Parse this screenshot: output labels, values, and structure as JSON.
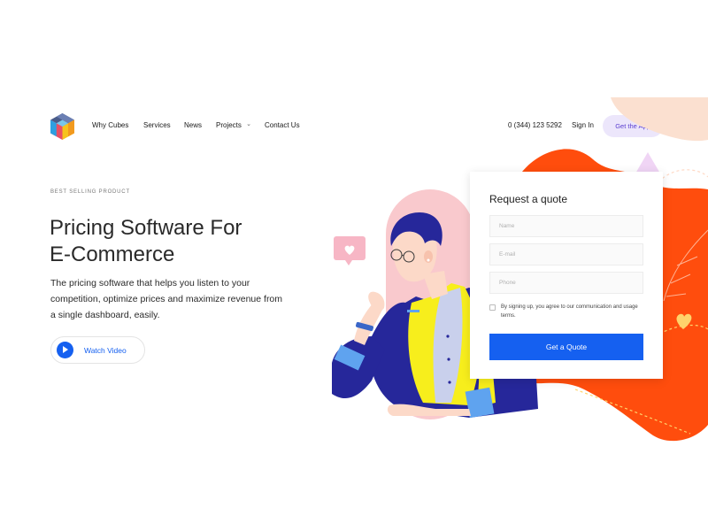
{
  "nav": {
    "items": [
      "Why Cubes",
      "Services",
      "News",
      "Projects",
      "Contact Us"
    ],
    "projects_caret": "⌄"
  },
  "header": {
    "phone": "0 (344) 123 5292",
    "signin_label": "Sign In",
    "get_app_label": "Get the App"
  },
  "hero": {
    "eyebrow": "BEST SELLING PRODUCT",
    "headline_line1": "Pricing Software For",
    "headline_line2": "E-Commerce",
    "lead": "The pricing software that helps you listen to your competition, optimize prices and maximize revenue from a single dashboard, easily.",
    "watch_label": "Watch Video"
  },
  "quote": {
    "title": "Request a quote",
    "name_placeholder": "Name",
    "email_placeholder": "E-mail",
    "phone_placeholder": "Phone",
    "agree_text": "By signing up, you agree to our communication and usage terms.",
    "submit_label": "Get a Quote"
  },
  "colors": {
    "accent": "#1560f0",
    "orange": "#ff4d0d",
    "pink": "#f9c9cd",
    "peach": "#fbe0d0",
    "navy": "#26279a",
    "yellow": "#f7ee1c",
    "purple_soft": "#ece6fb"
  }
}
